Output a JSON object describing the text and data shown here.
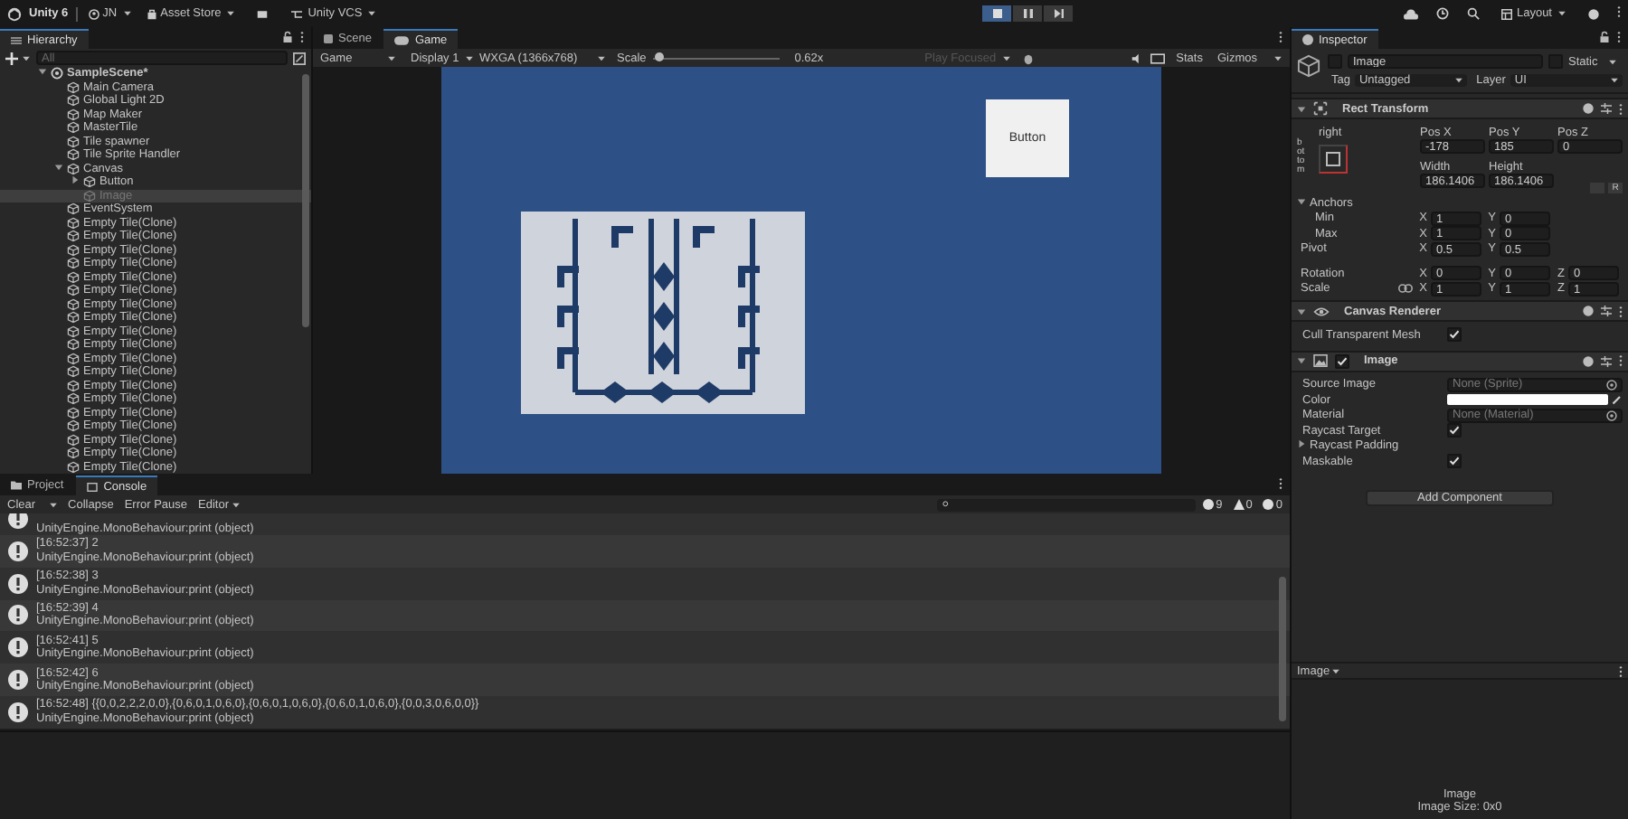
{
  "toolbar": {
    "logo": "Unity 6",
    "account": "JN",
    "asset_store": "Asset Store",
    "vcs": "Unity VCS",
    "layout": "Layout",
    "play_buttons": [
      {
        "kind": "play",
        "selected": true
      },
      {
        "kind": "pause",
        "selected": false
      },
      {
        "kind": "step",
        "selected": false
      }
    ]
  },
  "hierarchy": {
    "title": "Hierarchy",
    "search_placeholder": "All",
    "items": [
      {
        "label": "SampleScene*",
        "kind": "scene",
        "expanded": true,
        "selected": false,
        "children": [
          {
            "label": "Main Camera",
            "kind": "object",
            "selected": false
          },
          {
            "label": "Global Light 2D",
            "kind": "object",
            "selected": false
          },
          {
            "label": "Map Maker",
            "kind": "object",
            "selected": false
          },
          {
            "label": "MasterTile",
            "kind": "object",
            "selected": false
          },
          {
            "label": "Tile spawner",
            "kind": "object",
            "selected": false
          },
          {
            "label": "Tile Sprite Handler",
            "kind": "object",
            "selected": false
          },
          {
            "label": "Canvas",
            "kind": "object",
            "expanded": true,
            "selected": false,
            "children": [
              {
                "label": "Button",
                "kind": "object",
                "expanded": false,
                "selected": false
              },
              {
                "label": "Image",
                "kind": "object",
                "selected": true
              }
            ]
          },
          {
            "label": "EventSystem",
            "kind": "object",
            "selected": false
          },
          {
            "label": "Empty Tile(Clone)",
            "kind": "object",
            "selected": false
          },
          {
            "label": "Empty Tile(Clone)",
            "kind": "object",
            "selected": false
          },
          {
            "label": "Empty Tile(Clone)",
            "kind": "object",
            "selected": false
          },
          {
            "label": "Empty Tile(Clone)",
            "kind": "object",
            "selected": false
          },
          {
            "label": "Empty Tile(Clone)",
            "kind": "object",
            "selected": false
          },
          {
            "label": "Empty Tile(Clone)",
            "kind": "object",
            "selected": false
          },
          {
            "label": "Empty Tile(Clone)",
            "kind": "object",
            "selected": false
          },
          {
            "label": "Empty Tile(Clone)",
            "kind": "object",
            "selected": false
          },
          {
            "label": "Empty Tile(Clone)",
            "kind": "object",
            "selected": false
          },
          {
            "label": "Empty Tile(Clone)",
            "kind": "object",
            "selected": false
          },
          {
            "label": "Empty Tile(Clone)",
            "kind": "object",
            "selected": false
          },
          {
            "label": "Empty Tile(Clone)",
            "kind": "object",
            "selected": false
          },
          {
            "label": "Empty Tile(Clone)",
            "kind": "object",
            "selected": false
          },
          {
            "label": "Empty Tile(Clone)",
            "kind": "object",
            "selected": false
          },
          {
            "label": "Empty Tile(Clone)",
            "kind": "object",
            "selected": false
          },
          {
            "label": "Empty Tile(Clone)",
            "kind": "object",
            "selected": false
          },
          {
            "label": "Empty Tile(Clone)",
            "kind": "object",
            "selected": false
          },
          {
            "label": "Empty Tile(Clone)",
            "kind": "object",
            "selected": false
          },
          {
            "label": "Empty Tile(Clone)",
            "kind": "object",
            "selected": false
          }
        ]
      }
    ]
  },
  "game_view": {
    "tabs": [
      {
        "label": "Scene",
        "kind": "scene",
        "selected": false
      },
      {
        "label": "Game",
        "kind": "game",
        "selected": true
      }
    ],
    "mode": "Game",
    "display": "Display 1",
    "resolution": "WXGA (1366x768)",
    "scale_label": "Scale",
    "scale_slider": {
      "level": 0.01
    },
    "scale_value": "0.62x",
    "play_focused": "Play Focused",
    "stats": "Stats",
    "gizmos": "Gizmos",
    "ui_button": "Button"
  },
  "console": {
    "tabs": [
      {
        "label": "Project",
        "kind": "project",
        "selected": false
      },
      {
        "label": "Console",
        "kind": "console",
        "selected": true
      }
    ],
    "toolbar": [
      "Clear",
      "Collapse",
      "Error Pause",
      "Editor"
    ],
    "counts": {
      "info": "9",
      "warning": "0",
      "error": "0"
    },
    "entries": [
      {
        "trace": "UnityEngine.MonoBehaviour:print (object)"
      },
      {
        "message": "[16:52:37] 2",
        "trace": "UnityEngine.MonoBehaviour:print (object)"
      },
      {
        "message": "[16:52:38] 3",
        "trace": "UnityEngine.MonoBehaviour:print (object)"
      },
      {
        "message": "[16:52:39] 4",
        "trace": "UnityEngine.MonoBehaviour:print (object)"
      },
      {
        "message": "[16:52:41] 5",
        "trace": "UnityEngine.MonoBehaviour:print (object)"
      },
      {
        "message": "[16:52:42] 6",
        "trace": "UnityEngine.MonoBehaviour:print (object)"
      },
      {
        "message": "[16:52:48] {{0,0,2,2,2,0,0},{0,6,0,1,0,6,0},{0,6,0,1,0,6,0},{0,6,0,1,0,6,0},{0,0,3,0,6,0,0}}",
        "trace": "UnityEngine.MonoBehaviour:print (object)"
      }
    ]
  },
  "inspector": {
    "title": "Inspector",
    "name": "Image",
    "active": false,
    "static_label": "Static",
    "static": false,
    "tag_label": "Tag",
    "tag": "Untagged",
    "layer_label": "Layer",
    "layer": "UI",
    "rect_transform": {
      "title": "Rect Transform",
      "anchor_h": "right",
      "anchor_v": "bottom",
      "fields": [
        {
          "label": "Pos X",
          "value": "-178"
        },
        {
          "label": "Pos Y",
          "value": "185"
        },
        {
          "label": "Pos Z",
          "value": "0"
        },
        {
          "label": "Width",
          "value": "186.1406"
        },
        {
          "label": "Height",
          "value": "186.1406"
        }
      ],
      "raw_button": "R",
      "anchors_label": "Anchors",
      "anchors_expanded": true,
      "rows": [
        {
          "label": "Min",
          "indent": true,
          "gap": false,
          "linked": false,
          "axes": [
            {
              "axis": "X",
              "value": "1"
            },
            {
              "axis": "Y",
              "value": "0"
            }
          ]
        },
        {
          "label": "Max",
          "indent": true,
          "gap": false,
          "linked": false,
          "axes": [
            {
              "axis": "X",
              "value": "1"
            },
            {
              "axis": "Y",
              "value": "0"
            }
          ]
        },
        {
          "label": "Pivot",
          "indent": false,
          "gap": false,
          "linked": false,
          "axes": [
            {
              "axis": "X",
              "value": "0.5"
            },
            {
              "axis": "Y",
              "value": "0.5"
            }
          ]
        },
        {
          "label": "Rotation",
          "indent": false,
          "gap": true,
          "linked": false,
          "axes": [
            {
              "axis": "X",
              "value": "0"
            },
            {
              "axis": "Y",
              "value": "0"
            },
            {
              "axis": "Z",
              "value": "0"
            }
          ]
        },
        {
          "label": "Scale",
          "indent": false,
          "gap": false,
          "linked": true,
          "axes": [
            {
              "axis": "X",
              "value": "1"
            },
            {
              "axis": "Y",
              "value": "1"
            },
            {
              "axis": "Z",
              "value": "1"
            }
          ]
        }
      ]
    },
    "components": [
      {
        "title": "Canvas Renderer",
        "kind": "canvas_renderer",
        "rows": [
          {
            "kind": "check",
            "label": "Cull Transparent Mesh",
            "checked": true
          }
        ]
      },
      {
        "title": "Image",
        "kind": "image",
        "enabled": true,
        "rows": [
          {
            "kind": "object",
            "label": "Source Image",
            "value": "None (Sprite)"
          },
          {
            "kind": "color",
            "label": "Color",
            "color": "#ffffff"
          },
          {
            "kind": "object",
            "label": "Material",
            "value": "None (Material)"
          },
          {
            "kind": "check",
            "label": "Raycast Target",
            "checked": true
          },
          {
            "kind": "foldout",
            "label": "Raycast Padding",
            "expanded": false
          },
          {
            "kind": "check",
            "label": "Maskable",
            "checked": true
          }
        ]
      }
    ],
    "add_component": "Add Component",
    "preview_label": "Image",
    "preview_title": "Image",
    "preview_size": "Image Size: 0x0"
  }
}
